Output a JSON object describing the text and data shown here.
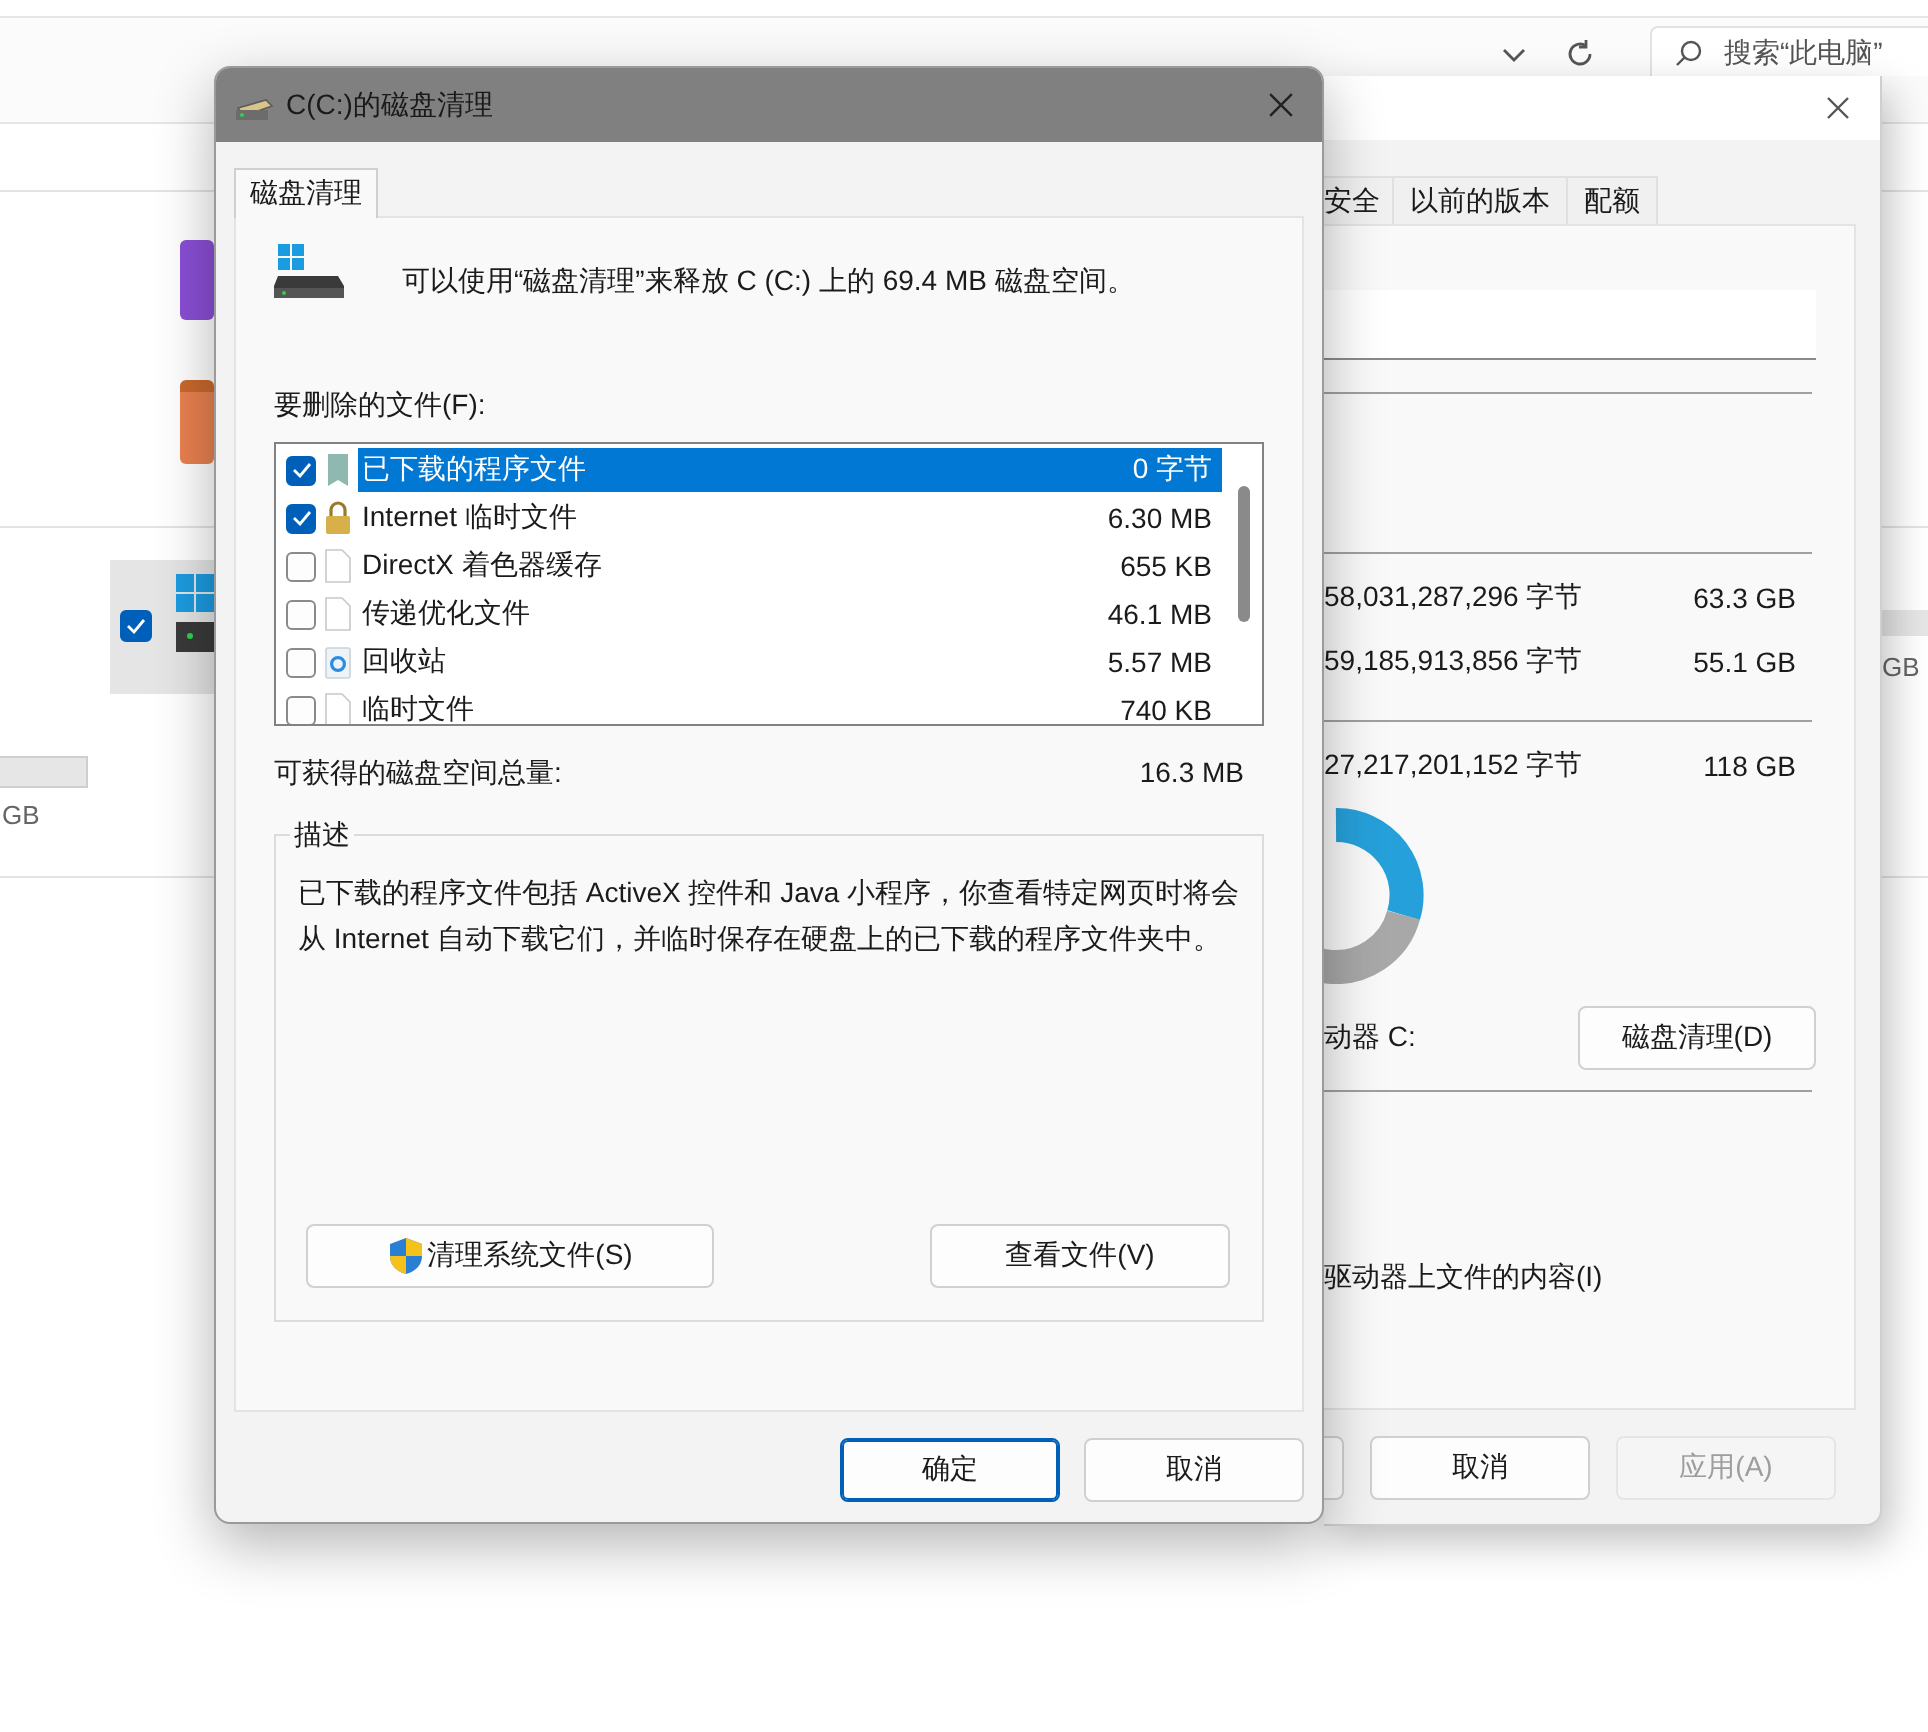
{
  "explorer": {
    "search": {
      "placeholder": "搜索“此电脑”"
    },
    "drive_tile": {
      "checked": true
    },
    "right_capacity": "GB",
    "left_capacity": "GB"
  },
  "properties_window": {
    "tabs": [
      {
        "label": "安全",
        "selected": false
      },
      {
        "label": "以前的版本",
        "selected": false
      },
      {
        "label": "配额",
        "selected": false
      }
    ],
    "space_rows": [
      {
        "bytes": "58,031,287,296 字节",
        "size": "63.3 GB"
      },
      {
        "bytes": "59,185,913,856 字节",
        "size": "55.1 GB"
      }
    ],
    "capacity_row": {
      "bytes": "27,217,201,152 字节",
      "size": "118 GB"
    },
    "drive_label": "动器 C:",
    "cleanup_button": "磁盘清理(D)",
    "index_option": "驱动器上文件的内容(I)",
    "buttons": [
      {
        "label": "取消",
        "disabled": false
      },
      {
        "label": "应用(A)",
        "disabled": true
      }
    ]
  },
  "cleanup_dialog": {
    "title": "C(C:)的磁盘清理",
    "tabs": [
      {
        "label": "磁盘清理",
        "selected": true
      }
    ],
    "intro": "可以使用“磁盘清理”来释放 C (C:) 上的 69.4 MB 磁盘空间。",
    "files_label": "要删除的文件(F):",
    "files": [
      {
        "name": "已下载的程序文件",
        "size": "0 字节",
        "checked": true,
        "selected": true,
        "kind": "program"
      },
      {
        "name": "Internet 临时文件",
        "size": "6.30 MB",
        "checked": true,
        "selected": false,
        "kind": "lock"
      },
      {
        "name": "DirectX 着色器缓存",
        "size": "655 KB",
        "checked": false,
        "selected": false,
        "kind": "file"
      },
      {
        "name": "传递优化文件",
        "size": "46.1 MB",
        "checked": false,
        "selected": false,
        "kind": "file"
      },
      {
        "name": "回收站",
        "size": "5.57 MB",
        "checked": false,
        "selected": false,
        "kind": "recycle"
      },
      {
        "name": "临时文件",
        "size": "740 KB",
        "checked": false,
        "selected": false,
        "kind": "file"
      }
    ],
    "total_label": "可获得的磁盘空间总量:",
    "total_value": "16.3 MB",
    "description_title": "描述",
    "description": "已下载的程序文件包括 ActiveX 控件和 Java 小程序，你查看特定网页时将会从 Internet 自动下载它们，并临时保存在硬盘上的已下载的程序文件夹中。",
    "clean_system_button": "清理系统文件(S)",
    "view_files_button": "查看文件(V)",
    "buttons": [
      {
        "label": "确定",
        "default": true
      },
      {
        "label": "取消",
        "default": false
      }
    ]
  }
}
